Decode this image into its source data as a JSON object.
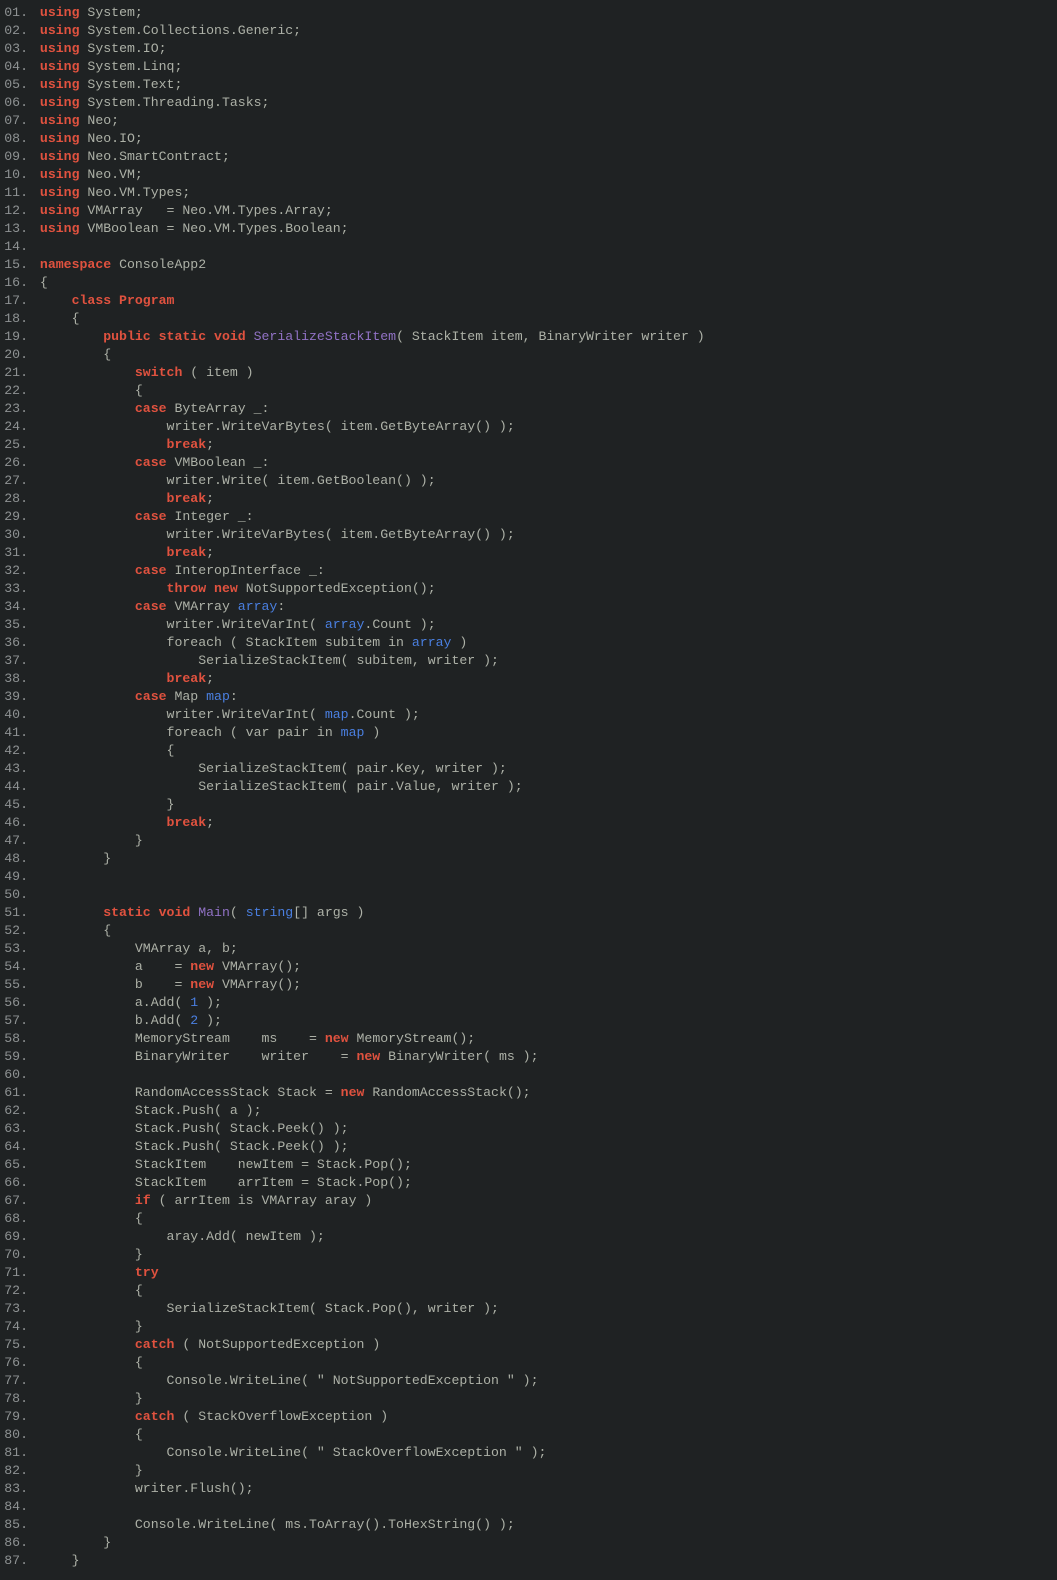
{
  "lines": [
    [
      {
        "c": "kw1",
        "t": "using"
      },
      {
        "c": "txt",
        "t": " System;"
      }
    ],
    [
      {
        "c": "kw1",
        "t": "using"
      },
      {
        "c": "txt",
        "t": " System.Collections.Generic;"
      }
    ],
    [
      {
        "c": "kw1",
        "t": "using"
      },
      {
        "c": "txt",
        "t": " System.IO;"
      }
    ],
    [
      {
        "c": "kw1",
        "t": "using"
      },
      {
        "c": "txt",
        "t": " System.Linq;"
      }
    ],
    [
      {
        "c": "kw1",
        "t": "using"
      },
      {
        "c": "txt",
        "t": " System.Text;"
      }
    ],
    [
      {
        "c": "kw1",
        "t": "using"
      },
      {
        "c": "txt",
        "t": " System.Threading.Tasks;"
      }
    ],
    [
      {
        "c": "kw1",
        "t": "using"
      },
      {
        "c": "txt",
        "t": " Neo;"
      }
    ],
    [
      {
        "c": "kw1",
        "t": "using"
      },
      {
        "c": "txt",
        "t": " Neo.IO;"
      }
    ],
    [
      {
        "c": "kw1",
        "t": "using"
      },
      {
        "c": "txt",
        "t": " Neo.SmartContract;"
      }
    ],
    [
      {
        "c": "kw1",
        "t": "using"
      },
      {
        "c": "txt",
        "t": " Neo.VM;"
      }
    ],
    [
      {
        "c": "kw1",
        "t": "using"
      },
      {
        "c": "txt",
        "t": " Neo.VM.Types;"
      }
    ],
    [
      {
        "c": "kw1",
        "t": "using"
      },
      {
        "c": "txt",
        "t": " VMArray   = Neo.VM.Types.Array;"
      }
    ],
    [
      {
        "c": "kw1",
        "t": "using"
      },
      {
        "c": "txt",
        "t": " VMBoolean = Neo.VM.Types.Boolean;"
      }
    ],
    [
      {
        "c": "txt",
        "t": ""
      }
    ],
    [
      {
        "c": "kw1",
        "t": "namespace"
      },
      {
        "c": "txt",
        "t": " ConsoleApp2"
      }
    ],
    [
      {
        "c": "txt",
        "t": "{"
      }
    ],
    [
      {
        "c": "txt",
        "t": "    "
      },
      {
        "c": "kw1",
        "t": "class Program"
      }
    ],
    [
      {
        "c": "txt",
        "t": "    {"
      }
    ],
    [
      {
        "c": "txt",
        "t": "        "
      },
      {
        "c": "kw1",
        "t": "public static void"
      },
      {
        "c": "txt",
        "t": " "
      },
      {
        "c": "method",
        "t": "SerializeStackItem"
      },
      {
        "c": "txt",
        "t": "( StackItem item, BinaryWriter writer )"
      }
    ],
    [
      {
        "c": "txt",
        "t": "        {"
      }
    ],
    [
      {
        "c": "txt",
        "t": "            "
      },
      {
        "c": "kw1",
        "t": "switch"
      },
      {
        "c": "txt",
        "t": " ( item )"
      }
    ],
    [
      {
        "c": "txt",
        "t": "            {"
      }
    ],
    [
      {
        "c": "txt",
        "t": "            "
      },
      {
        "c": "kw1",
        "t": "case"
      },
      {
        "c": "txt",
        "t": " ByteArray _:"
      }
    ],
    [
      {
        "c": "txt",
        "t": "                writer.WriteVarBytes( item.GetByteArray() );"
      }
    ],
    [
      {
        "c": "txt",
        "t": "                "
      },
      {
        "c": "kw1",
        "t": "break"
      },
      {
        "c": "txt",
        "t": ";"
      }
    ],
    [
      {
        "c": "txt",
        "t": "            "
      },
      {
        "c": "kw1",
        "t": "case"
      },
      {
        "c": "txt",
        "t": " VMBoolean _:"
      }
    ],
    [
      {
        "c": "txt",
        "t": "                writer.Write( item.GetBoolean() );"
      }
    ],
    [
      {
        "c": "txt",
        "t": "                "
      },
      {
        "c": "kw1",
        "t": "break"
      },
      {
        "c": "txt",
        "t": ";"
      }
    ],
    [
      {
        "c": "txt",
        "t": "            "
      },
      {
        "c": "kw1",
        "t": "case"
      },
      {
        "c": "txt",
        "t": " Integer _:"
      }
    ],
    [
      {
        "c": "txt",
        "t": "                writer.WriteVarBytes( item.GetByteArray() );"
      }
    ],
    [
      {
        "c": "txt",
        "t": "                "
      },
      {
        "c": "kw1",
        "t": "break"
      },
      {
        "c": "txt",
        "t": ";"
      }
    ],
    [
      {
        "c": "txt",
        "t": "            "
      },
      {
        "c": "kw1",
        "t": "case"
      },
      {
        "c": "txt",
        "t": " InteropInterface _:"
      }
    ],
    [
      {
        "c": "txt",
        "t": "                "
      },
      {
        "c": "kw1",
        "t": "throw new"
      },
      {
        "c": "txt",
        "t": " NotSupportedException();"
      }
    ],
    [
      {
        "c": "txt",
        "t": "            "
      },
      {
        "c": "kw1",
        "t": "case"
      },
      {
        "c": "txt",
        "t": " VMArray "
      },
      {
        "c": "varhl",
        "t": "array"
      },
      {
        "c": "txt",
        "t": ":"
      }
    ],
    [
      {
        "c": "txt",
        "t": "                writer.WriteVarInt( "
      },
      {
        "c": "varhl",
        "t": "array"
      },
      {
        "c": "txt",
        "t": ".Count );"
      }
    ],
    [
      {
        "c": "txt",
        "t": "                foreach ( StackItem subitem in "
      },
      {
        "c": "varhl",
        "t": "array"
      },
      {
        "c": "txt",
        "t": " )"
      }
    ],
    [
      {
        "c": "txt",
        "t": "                    SerializeStackItem( subitem, writer );"
      }
    ],
    [
      {
        "c": "txt",
        "t": "                "
      },
      {
        "c": "kw1",
        "t": "break"
      },
      {
        "c": "txt",
        "t": ";"
      }
    ],
    [
      {
        "c": "txt",
        "t": "            "
      },
      {
        "c": "kw1",
        "t": "case"
      },
      {
        "c": "txt",
        "t": " Map "
      },
      {
        "c": "varhl",
        "t": "map"
      },
      {
        "c": "txt",
        "t": ":"
      }
    ],
    [
      {
        "c": "txt",
        "t": "                writer.WriteVarInt( "
      },
      {
        "c": "varhl",
        "t": "map"
      },
      {
        "c": "txt",
        "t": ".Count );"
      }
    ],
    [
      {
        "c": "txt",
        "t": "                foreach ( var pair in "
      },
      {
        "c": "varhl",
        "t": "map"
      },
      {
        "c": "txt",
        "t": " )"
      }
    ],
    [
      {
        "c": "txt",
        "t": "                {"
      }
    ],
    [
      {
        "c": "txt",
        "t": "                    SerializeStackItem( pair.Key, writer );"
      }
    ],
    [
      {
        "c": "txt",
        "t": "                    SerializeStackItem( pair.Value, writer );"
      }
    ],
    [
      {
        "c": "txt",
        "t": "                }"
      }
    ],
    [
      {
        "c": "txt",
        "t": "                "
      },
      {
        "c": "kw1",
        "t": "break"
      },
      {
        "c": "txt",
        "t": ";"
      }
    ],
    [
      {
        "c": "txt",
        "t": "            }"
      }
    ],
    [
      {
        "c": "txt",
        "t": "        }"
      }
    ],
    [
      {
        "c": "txt",
        "t": ""
      }
    ],
    [
      {
        "c": "txt",
        "t": ""
      }
    ],
    [
      {
        "c": "txt",
        "t": "        "
      },
      {
        "c": "kw1",
        "t": "static void"
      },
      {
        "c": "txt",
        "t": " "
      },
      {
        "c": "method",
        "t": "Main"
      },
      {
        "c": "txt",
        "t": "( "
      },
      {
        "c": "kw2",
        "t": "string"
      },
      {
        "c": "txt",
        "t": "[] args )"
      }
    ],
    [
      {
        "c": "txt",
        "t": "        {"
      }
    ],
    [
      {
        "c": "txt",
        "t": "            VMArray a, b;"
      }
    ],
    [
      {
        "c": "txt",
        "t": "            a    = "
      },
      {
        "c": "kw1",
        "t": "new"
      },
      {
        "c": "txt",
        "t": " VMArray();"
      }
    ],
    [
      {
        "c": "txt",
        "t": "            b    = "
      },
      {
        "c": "kw1",
        "t": "new"
      },
      {
        "c": "txt",
        "t": " VMArray();"
      }
    ],
    [
      {
        "c": "txt",
        "t": "            a.Add( "
      },
      {
        "c": "num",
        "t": "1"
      },
      {
        "c": "txt",
        "t": " );"
      }
    ],
    [
      {
        "c": "txt",
        "t": "            b.Add( "
      },
      {
        "c": "num",
        "t": "2"
      },
      {
        "c": "txt",
        "t": " );"
      }
    ],
    [
      {
        "c": "txt",
        "t": "            MemoryStream    ms    = "
      },
      {
        "c": "kw1",
        "t": "new"
      },
      {
        "c": "txt",
        "t": " MemoryStream();"
      }
    ],
    [
      {
        "c": "txt",
        "t": "            BinaryWriter    writer    = "
      },
      {
        "c": "kw1",
        "t": "new"
      },
      {
        "c": "txt",
        "t": " BinaryWriter( ms );"
      }
    ],
    [
      {
        "c": "txt",
        "t": ""
      }
    ],
    [
      {
        "c": "txt",
        "t": "            RandomAccessStack Stack = "
      },
      {
        "c": "kw1",
        "t": "new"
      },
      {
        "c": "txt",
        "t": " RandomAccessStack();"
      }
    ],
    [
      {
        "c": "txt",
        "t": "            Stack.Push( a );"
      }
    ],
    [
      {
        "c": "txt",
        "t": "            Stack.Push( Stack.Peek() );"
      }
    ],
    [
      {
        "c": "txt",
        "t": "            Stack.Push( Stack.Peek() );"
      }
    ],
    [
      {
        "c": "txt",
        "t": "            StackItem    newItem = Stack.Pop();"
      }
    ],
    [
      {
        "c": "txt",
        "t": "            StackItem    arrItem = Stack.Pop();"
      }
    ],
    [
      {
        "c": "txt",
        "t": "            "
      },
      {
        "c": "kw1",
        "t": "if"
      },
      {
        "c": "txt",
        "t": " ( arrItem is VMArray aray )"
      }
    ],
    [
      {
        "c": "txt",
        "t": "            {"
      }
    ],
    [
      {
        "c": "txt",
        "t": "                aray.Add( newItem );"
      }
    ],
    [
      {
        "c": "txt",
        "t": "            }"
      }
    ],
    [
      {
        "c": "txt",
        "t": "            "
      },
      {
        "c": "kw1",
        "t": "try"
      }
    ],
    [
      {
        "c": "txt",
        "t": "            {"
      }
    ],
    [
      {
        "c": "txt",
        "t": "                SerializeStackItem( Stack.Pop(), writer );"
      }
    ],
    [
      {
        "c": "txt",
        "t": "            }"
      }
    ],
    [
      {
        "c": "txt",
        "t": "            "
      },
      {
        "c": "kw1",
        "t": "catch"
      },
      {
        "c": "txt",
        "t": " ( NotSupportedException )"
      }
    ],
    [
      {
        "c": "txt",
        "t": "            {"
      }
    ],
    [
      {
        "c": "txt",
        "t": "                Console.WriteLine( "
      },
      {
        "c": "str",
        "t": "\" NotSupportedException \""
      },
      {
        "c": "txt",
        "t": " );"
      }
    ],
    [
      {
        "c": "txt",
        "t": "            }"
      }
    ],
    [
      {
        "c": "txt",
        "t": "            "
      },
      {
        "c": "kw1",
        "t": "catch"
      },
      {
        "c": "txt",
        "t": " ( StackOverflowException )"
      }
    ],
    [
      {
        "c": "txt",
        "t": "            {"
      }
    ],
    [
      {
        "c": "txt",
        "t": "                Console.WriteLine( "
      },
      {
        "c": "str",
        "t": "\" StackOverflowException \""
      },
      {
        "c": "txt",
        "t": " );"
      }
    ],
    [
      {
        "c": "txt",
        "t": "            }"
      }
    ],
    [
      {
        "c": "txt",
        "t": "            writer.Flush();"
      }
    ],
    [
      {
        "c": "txt",
        "t": ""
      }
    ],
    [
      {
        "c": "txt",
        "t": "            Console.WriteLine( ms.ToArray().ToHexString() );"
      }
    ],
    [
      {
        "c": "txt",
        "t": "        }"
      }
    ],
    [
      {
        "c": "txt",
        "t": "    }"
      }
    ]
  ]
}
